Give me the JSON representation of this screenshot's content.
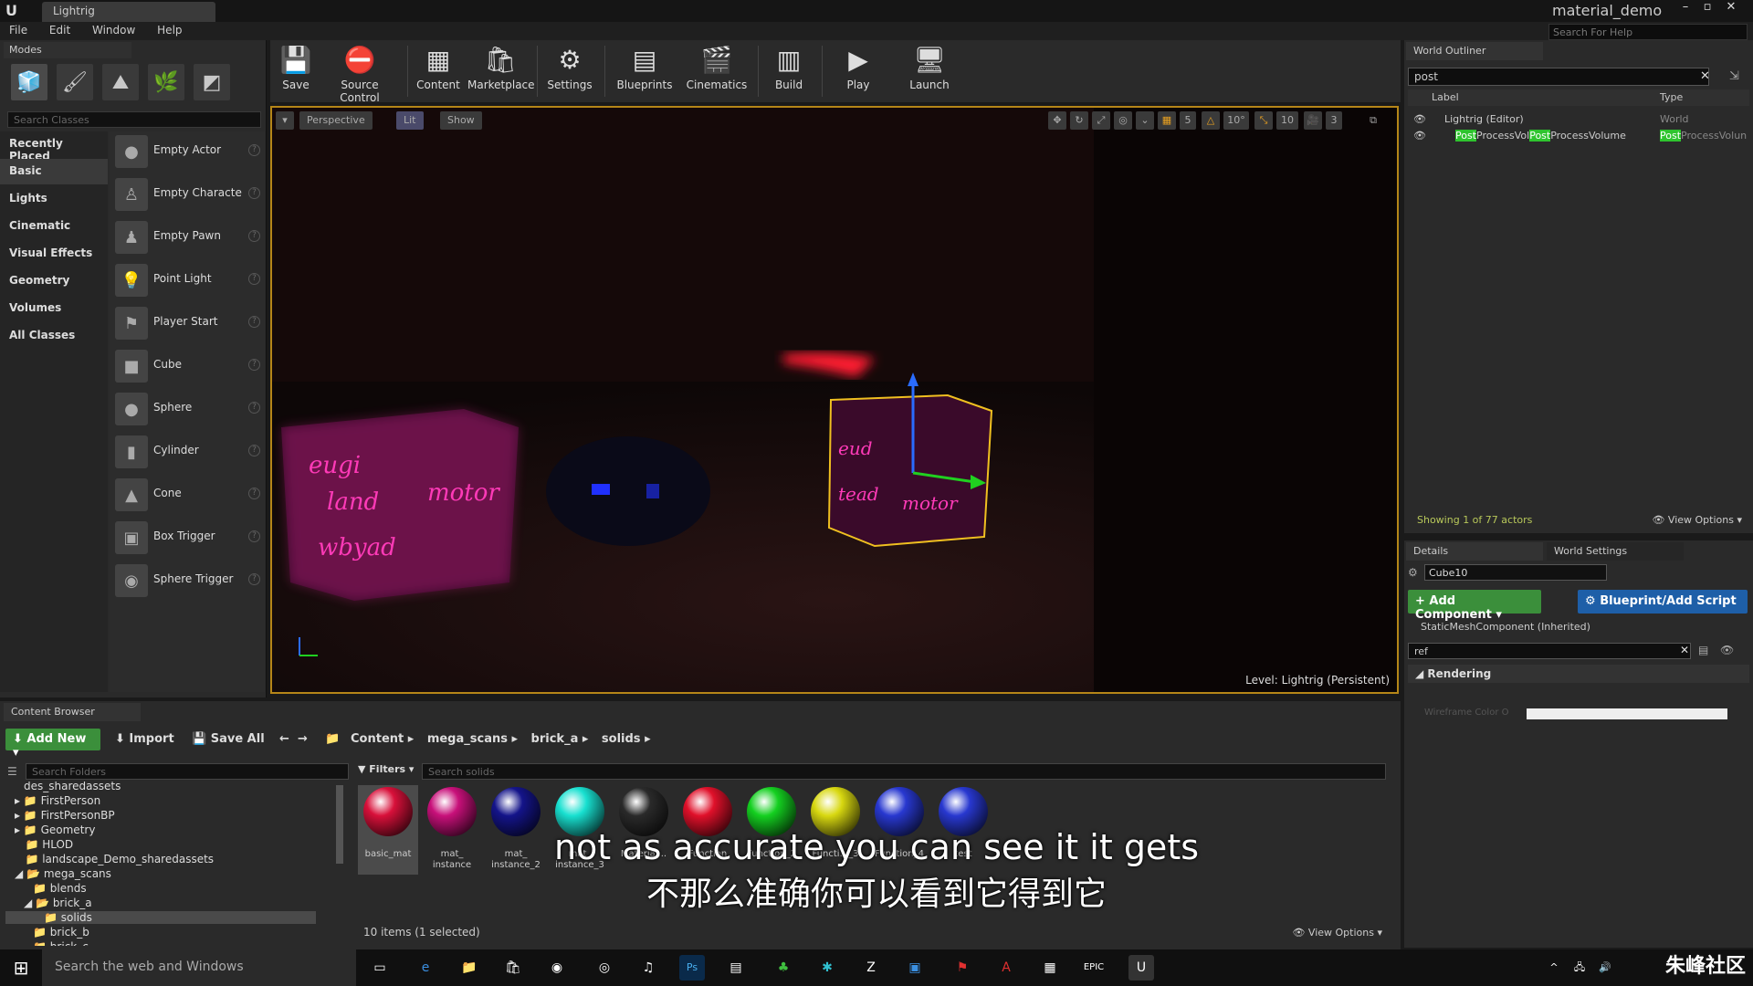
{
  "window": {
    "tab": "Lightrig",
    "project": "material_demo",
    "help_placeholder": "Search For Help"
  },
  "menu": [
    "File",
    "Edit",
    "Window",
    "Help"
  ],
  "modes": {
    "tab": "Modes",
    "search_placeholder": "Search Classes",
    "categories": [
      "Recently Placed",
      "Basic",
      "Lights",
      "Cinematic",
      "Visual Effects",
      "Geometry",
      "Volumes",
      "All Classes"
    ],
    "actors": [
      "Empty Actor",
      "Empty Characte",
      "Empty Pawn",
      "Point Light",
      "Player Start",
      "Cube",
      "Sphere",
      "Cylinder",
      "Cone",
      "Box Trigger",
      "Sphere Trigger"
    ]
  },
  "toolbar": [
    "Save",
    "Source Control",
    "Content",
    "Marketplace",
    "Settings",
    "Blueprints",
    "Cinematics",
    "Build",
    "Play",
    "Launch"
  ],
  "viewport": {
    "perspective": "Perspective",
    "lit": "Lit",
    "show": "Show",
    "snap_values": [
      "5",
      "10°",
      "10",
      "3"
    ],
    "level_label": "Level:  Lightrig (Persistent)",
    "cube_text": [
      "eugi",
      "land",
      "motor",
      "wbyad",
      "eud",
      "tead",
      "motor"
    ]
  },
  "outliner": {
    "tab": "World Outliner",
    "search_value": "post",
    "col_label": "Label",
    "col_type": "Type",
    "rows": [
      {
        "label": "Lightrig (Editor)",
        "type": "World"
      },
      {
        "label_a": "Post",
        "label_b": "ProcessVol",
        "label_c": "Post",
        "label_d": "ProcessVolume",
        "type_a": "Post",
        "type_b": "ProcessVolun"
      }
    ],
    "status": "Showing 1 of 77 actors",
    "view_options": "View Options"
  },
  "details": {
    "tab_details": "Details",
    "tab_world": "World Settings",
    "actor_name": "Cube10",
    "add_component": "+ Add Component",
    "blueprint": "Blueprint/Add Script",
    "component": "StaticMeshComponent (Inherited)",
    "search_value": "ref",
    "section": "Rendering",
    "wireframe_label": "Wireframe Color O"
  },
  "content_browser": {
    "tab": "Content Browser",
    "add_new": "Add New",
    "import": "Import",
    "save_all": "Save All",
    "path": [
      "Content",
      "mega_scans",
      "brick_a",
      "solids"
    ],
    "folder_search": "Search Folders",
    "folders": [
      "des_sharedassets",
      "FirstPerson",
      "FirstPersonBP",
      "Geometry",
      "HLOD",
      "landscape_Demo_sharedassets",
      "mega_scans",
      "blends",
      "brick_a",
      "solids",
      "brick_b",
      "brick_c"
    ],
    "filters": "Filters",
    "asset_search": "Search solids",
    "assets": [
      {
        "name": "basic_mat",
        "color": "#d8103a"
      },
      {
        "name": "mat_ instance",
        "color": "#c8107a"
      },
      {
        "name": "mat_ instance_2",
        "color": "#14148a"
      },
      {
        "name": "mat_ instance_3",
        "color": "#18e0d0"
      },
      {
        "name": "Material...",
        "color": "#2a2a2a"
      },
      {
        "name": "Function",
        "color": "#e0102a"
      },
      {
        "name": "Function_2",
        "color": "#14d020"
      },
      {
        "name": "Functi..._3",
        "color": "#d8d810"
      },
      {
        "name": "Function_4",
        "color": "#2838d0"
      },
      {
        "name": "test",
        "color": "#2838d0"
      }
    ],
    "count": "10 items (1 selected)",
    "view_options": "View Options"
  },
  "subtitles": {
    "en": "not as accurate you can see it it gets",
    "zh": "不那么准确你可以看到它得到它"
  },
  "taskbar": {
    "search": "Search the web and Windows",
    "watermark": "朱峰社区"
  }
}
